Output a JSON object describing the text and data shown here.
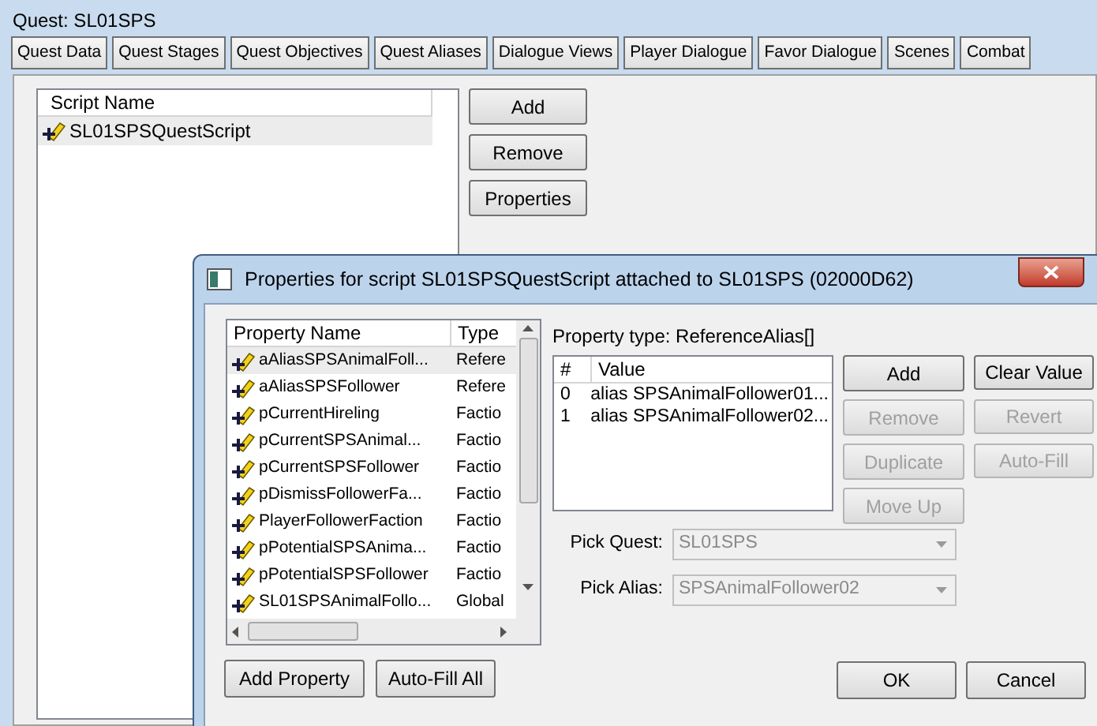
{
  "main_window": {
    "title": "Quest: SL01SPS",
    "tabs": [
      {
        "label": "Quest Data"
      },
      {
        "label": "Quest Stages"
      },
      {
        "label": "Quest Objectives"
      },
      {
        "label": "Quest Aliases"
      },
      {
        "label": "Dialogue Views"
      },
      {
        "label": "Player Dialogue"
      },
      {
        "label": "Favor Dialogue"
      },
      {
        "label": "Scenes"
      },
      {
        "label": "Combat"
      }
    ],
    "scripts": {
      "column": "Script Name",
      "rows": [
        {
          "name": "SL01SPSQuestScript",
          "selected": true
        }
      ]
    },
    "buttons": [
      {
        "label": "Add"
      },
      {
        "label": "Remove"
      },
      {
        "label": "Properties"
      }
    ]
  },
  "dialog": {
    "title": "Properties for script SL01SPSQuestScript attached to SL01SPS (02000D62)",
    "property_list": {
      "columns": [
        "Property Name",
        "Type"
      ],
      "rows": [
        {
          "name": "aAliasSPSAnimalFoll...",
          "type": "Refere",
          "selected": true
        },
        {
          "name": "aAliasSPSFollower",
          "type": "Refere",
          "selected": false
        },
        {
          "name": "pCurrentHireling",
          "type": "Factio",
          "selected": false
        },
        {
          "name": "pCurrentSPSAnimal...",
          "type": "Factio",
          "selected": false
        },
        {
          "name": "pCurrentSPSFollower",
          "type": "Factio",
          "selected": false
        },
        {
          "name": "pDismissFollowerFa...",
          "type": "Factio",
          "selected": false
        },
        {
          "name": "PlayerFollowerFaction",
          "type": "Factio",
          "selected": false
        },
        {
          "name": "pPotentialSPSAnima...",
          "type": "Factio",
          "selected": false
        },
        {
          "name": "pPotentialSPSFollower",
          "type": "Factio",
          "selected": false
        },
        {
          "name": "SL01SPSAnimalFollo...",
          "type": "Global",
          "selected": false
        }
      ]
    },
    "list_buttons": [
      {
        "label": "Add Property"
      },
      {
        "label": "Auto-Fill All"
      }
    ],
    "property_type": "Property type: ReferenceAlias[]",
    "values": {
      "columns": [
        "#",
        "Value"
      ],
      "rows": [
        {
          "index": "0",
          "value": "alias SPSAnimalFollower01..."
        },
        {
          "index": "1",
          "value": "alias SPSAnimalFollower02..."
        }
      ]
    },
    "value_buttons": [
      {
        "label": "Add",
        "disabled": false
      },
      {
        "label": "Remove",
        "disabled": true
      },
      {
        "label": "Duplicate",
        "disabled": true
      },
      {
        "label": "Move Up",
        "disabled": true
      }
    ],
    "side_buttons": [
      {
        "label": "Clear Value",
        "disabled": false
      },
      {
        "label": "Revert",
        "disabled": true
      },
      {
        "label": "Auto-Fill",
        "disabled": true
      }
    ],
    "pickers": [
      {
        "label": "Pick Quest:",
        "value": "SL01SPS",
        "disabled": true
      },
      {
        "label": "Pick Alias:",
        "value": "SPSAnimalFollower02",
        "disabled": true
      }
    ],
    "footer_buttons": [
      {
        "label": "OK"
      },
      {
        "label": "Cancel"
      }
    ]
  }
}
